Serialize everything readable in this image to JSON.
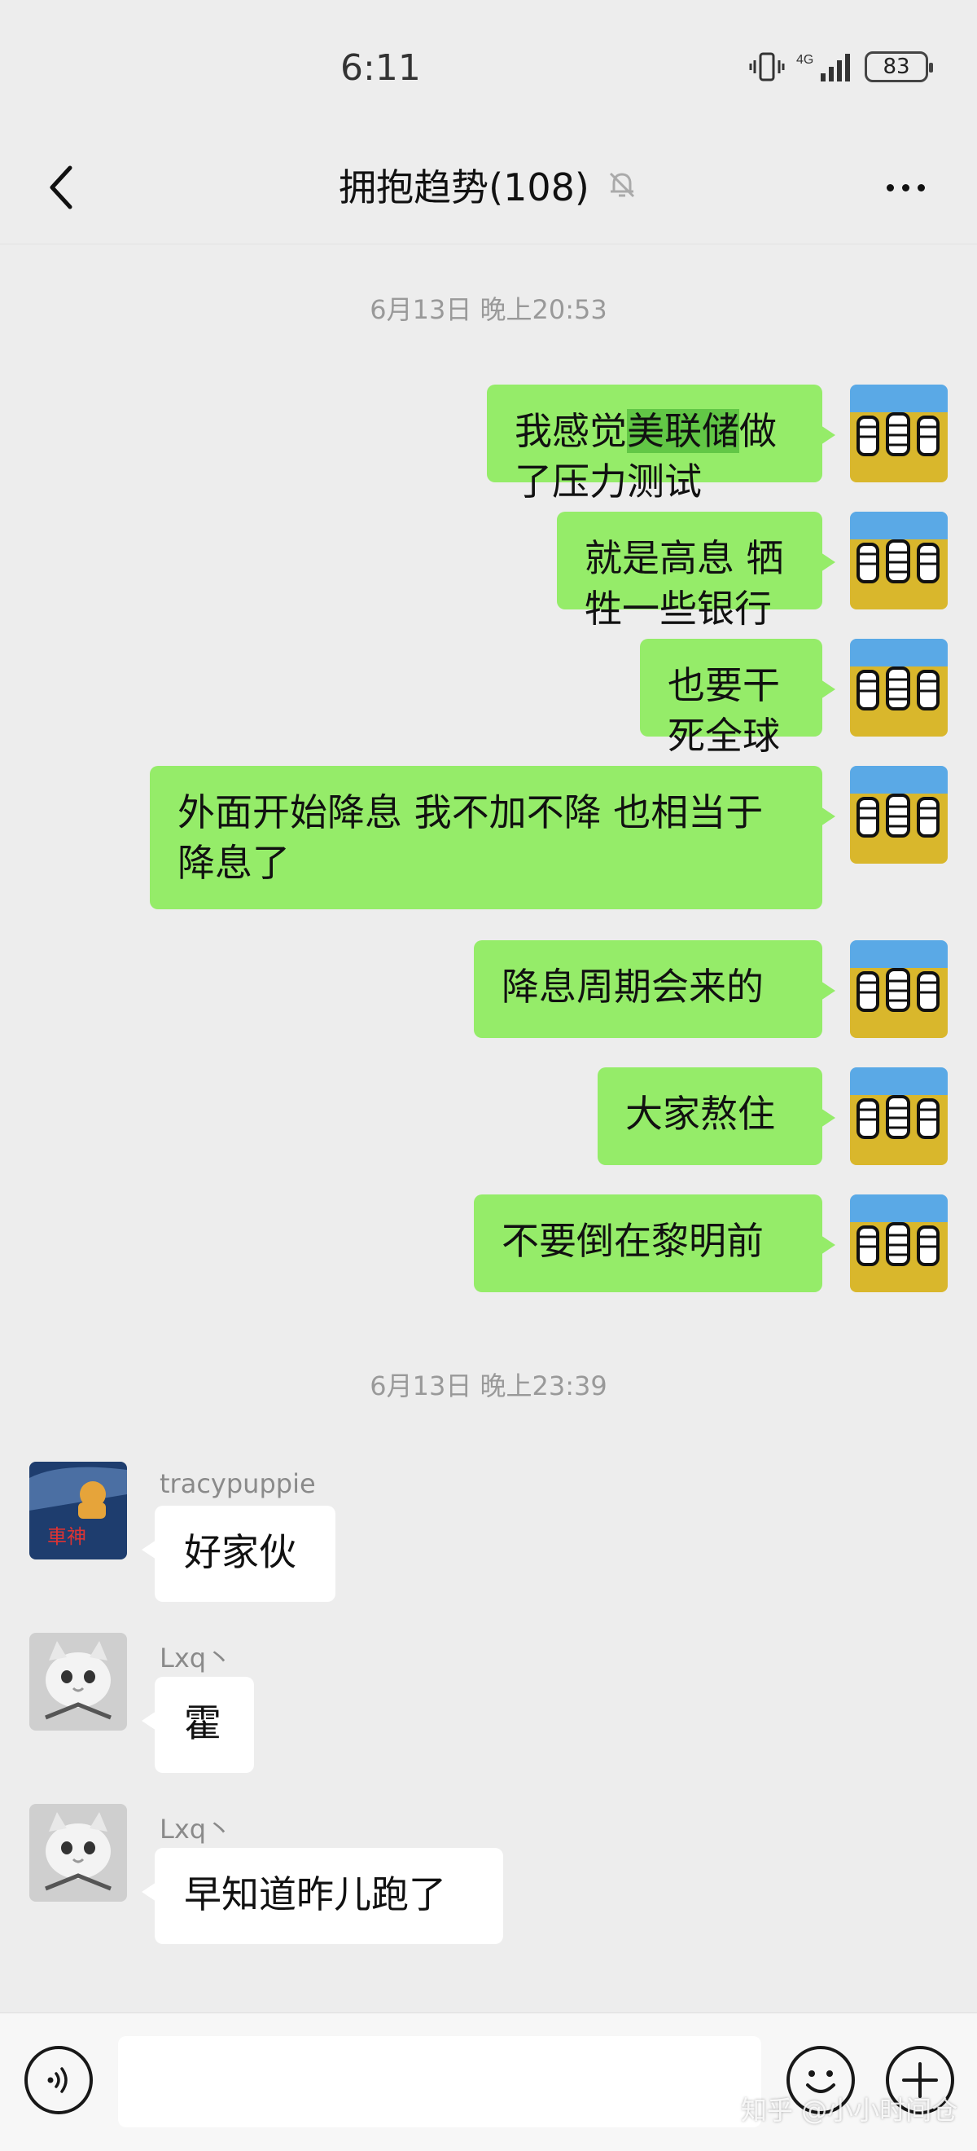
{
  "status_bar": {
    "time": "6:11",
    "network": "4G",
    "battery": "83"
  },
  "nav": {
    "title": "拥抱趋势(108)"
  },
  "timestamps": [
    "6月13日 晚上20:53",
    "6月13日 晚上23:39"
  ],
  "sent_messages": [
    {
      "pre": "我感觉",
      "highlight": "美联储",
      "post": "做了压力测试"
    },
    {
      "pre": "就是高息 牺牲一些银行",
      "highlight": "",
      "post": ""
    },
    {
      "pre": "也要干死全球",
      "highlight": "",
      "post": ""
    },
    {
      "pre": "外面开始降息 我不加不降 也相当于降息了",
      "highlight": "",
      "post": ""
    },
    {
      "pre": "降息周期会来的",
      "highlight": "",
      "post": ""
    },
    {
      "pre": "大家熬住",
      "highlight": "",
      "post": ""
    },
    {
      "pre": "不要倒在黎明前",
      "highlight": "",
      "post": ""
    }
  ],
  "received_messages": [
    {
      "sender": "tracypuppie",
      "text": "好家伙",
      "avatar_caption": "車神"
    },
    {
      "sender": "Lxq丶",
      "text": "霍"
    },
    {
      "sender": "Lxq丶",
      "text": "早知道昨儿跑了"
    }
  ],
  "input": {
    "placeholder": ""
  },
  "watermark": "知乎 @小小时间仓",
  "colors": {
    "background": "#ededed",
    "sent_bubble": "#95ec69",
    "received_bubble": "#ffffff",
    "highlight": "#62c746"
  }
}
